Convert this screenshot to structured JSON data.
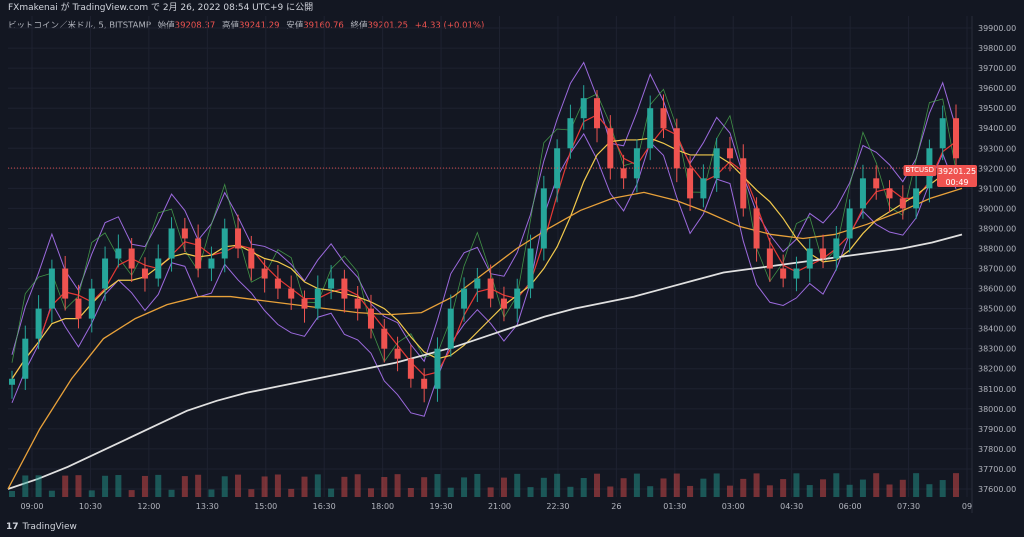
{
  "header": {
    "published_line": "FXmakenai が TradingView.com で 2月 26, 2022 08:54 UTC+9 に公開"
  },
  "legend": {
    "symbol": "ビットコイン／米ドル, 5, BITSTAMP",
    "open_label": "始値",
    "open": "39208.37",
    "high_label": "高値",
    "high": "39241.29",
    "low_label": "安値",
    "low": "39160.76",
    "close_label": "終値",
    "close": "39201.25",
    "change": "+4.33 (+0.01%)"
  },
  "price_tag": {
    "symbol": "BTCUSD",
    "price": "39201.25",
    "countdown": "00:49"
  },
  "brand": {
    "name": "TradingView"
  },
  "colors": {
    "background": "#131722",
    "up": "#26a69a",
    "down": "#ef5350",
    "ma_white": "#e0e0e0",
    "ma_orange": "#e8a13a",
    "ma_yellow": "#f2c94c",
    "ma_red": "#e53935",
    "bollinger": "#9c6ade",
    "lagging": "#4caf50",
    "grid": "#1e2230"
  },
  "chart_data": {
    "type": "candlestick",
    "title": "",
    "xlabel": "",
    "ylabel": "",
    "ylim": [
      37560,
      39960
    ],
    "y_ticks": [
      37600,
      37700,
      37800,
      37900,
      38000,
      38100,
      38200,
      38300,
      38400,
      38500,
      38600,
      38700,
      38800,
      38900,
      39000,
      39100,
      39200,
      39300,
      39400,
      39500,
      39600,
      39700,
      39800,
      39900
    ],
    "x_ticks": [
      "09:00",
      "10:30",
      "12:00",
      "13:30",
      "15:00",
      "16:30",
      "18:00",
      "19:30",
      "21:00",
      "22:30",
      "26",
      "01:30",
      "03:00",
      "04:30",
      "06:00",
      "07:30",
      "09"
    ],
    "series": [
      {
        "role": "price",
        "values": [
          38150,
          38350,
          38500,
          38700,
          38550,
          38450,
          38600,
          38750,
          38800,
          38700,
          38650,
          38750,
          38900,
          38850,
          38700,
          38750,
          38900,
          38800,
          38700,
          38650,
          38600,
          38550,
          38500,
          38600,
          38650,
          38550,
          38500,
          38400,
          38300,
          38250,
          38150,
          38100,
          38300,
          38500,
          38600,
          38650,
          38550,
          38500,
          38600,
          38800,
          39100,
          39300,
          39450,
          39550,
          39400,
          39200,
          39150,
          39300,
          39500,
          39400,
          39200,
          39050,
          39150,
          39300,
          39250,
          39000,
          38800,
          38700,
          38650,
          38700,
          38800,
          38750,
          38850,
          39000,
          39150,
          39100,
          39050,
          39000,
          39100,
          39300,
          39450,
          39250
        ]
      },
      {
        "role": "ma_white",
        "values": [
          37600,
          37650,
          37710,
          37780,
          37850,
          37920,
          37990,
          38040,
          38080,
          38110,
          38140,
          38170,
          38200,
          38230,
          38270,
          38310,
          38360,
          38410,
          38460,
          38500,
          38530,
          38560,
          38600,
          38640,
          38680,
          38700,
          38720,
          38740,
          38760,
          38780,
          38800,
          38830,
          38870
        ]
      },
      {
        "role": "ma_orange",
        "values": [
          37600,
          37900,
          38150,
          38350,
          38450,
          38520,
          38560,
          38560,
          38540,
          38520,
          38500,
          38480,
          38470,
          38480,
          38560,
          38680,
          38800,
          38900,
          38990,
          39050,
          39080,
          39040,
          38980,
          38910,
          38870,
          38850,
          38870,
          38920,
          38980,
          39050,
          39100
        ]
      }
    ],
    "volume_range": [
      0,
      1
    ]
  }
}
